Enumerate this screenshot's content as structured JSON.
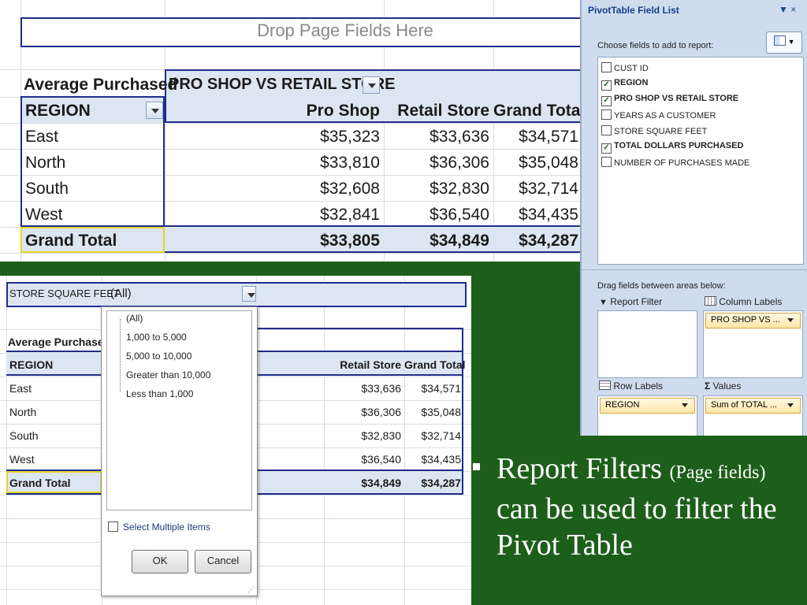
{
  "pivot_top": {
    "drop_zone": "Drop Page Fields Here",
    "data_label": "Average Purchased",
    "column_field": "PRO SHOP VS RETAIL STORE",
    "row_field": "REGION",
    "columns": [
      "Pro Shop",
      "Retail Store",
      "Grand Total"
    ],
    "rows": [
      {
        "label": "East",
        "values": [
          "$35,323",
          "$33,636",
          "$34,571"
        ]
      },
      {
        "label": "North",
        "values": [
          "$33,810",
          "$36,306",
          "$35,048"
        ]
      },
      {
        "label": "South",
        "values": [
          "$32,608",
          "$32,830",
          "$32,714"
        ]
      },
      {
        "label": "West",
        "values": [
          "$32,841",
          "$36,540",
          "$34,435"
        ]
      }
    ],
    "grand_total": {
      "label": "Grand Total",
      "values": [
        "$33,805",
        "$34,849",
        "$34,287"
      ]
    }
  },
  "field_list": {
    "title": "PivotTable Field List",
    "controls": "▼ ×",
    "choose_label": "Choose fields to add to report:",
    "fields": [
      {
        "name": "CUST ID",
        "checked": false
      },
      {
        "name": "REGION",
        "checked": true
      },
      {
        "name": "PRO SHOP VS RETAIL STORE",
        "checked": true
      },
      {
        "name": "YEARS AS A CUSTOMER",
        "checked": false
      },
      {
        "name": "STORE SQUARE FEET",
        "checked": false
      },
      {
        "name": "TOTAL DOLLARS PURCHASED",
        "checked": true
      },
      {
        "name": "NUMBER OF PURCHASES MADE",
        "checked": false
      }
    ],
    "drag_label": "Drag fields between areas below:",
    "report_filter_label": "Report Filter",
    "column_labels_label": "Column Labels",
    "column_pill": "PRO SHOP VS ...",
    "row_labels_label": "Row Labels",
    "values_label": "Values",
    "row_pill": "REGION",
    "values_pill": "Sum of TOTAL ..."
  },
  "pivot_bottom": {
    "filter_field": "STORE SQUARE FEET",
    "filter_value": "(All)",
    "data_label": "Average Purchased",
    "row_field": "REGION",
    "columns": [
      "Retail Store",
      "Grand Total"
    ],
    "rows": [
      {
        "label": "East",
        "values": [
          "$33,636",
          "$34,571"
        ]
      },
      {
        "label": "North",
        "values": [
          "$36,306",
          "$35,048"
        ]
      },
      {
        "label": "South",
        "values": [
          "$32,830",
          "$32,714"
        ]
      },
      {
        "label": "West",
        "values": [
          "$36,540",
          "$34,435"
        ]
      }
    ],
    "grand_total": {
      "label": "Grand Total",
      "values": [
        "$34,849",
        "$34,287"
      ]
    },
    "dropdown": {
      "items": [
        "(All)",
        "1,000 to 5,000",
        "5,000 to 10,000",
        "Greater than 10,000",
        "Less than 1,000"
      ],
      "select_multiple": "Select Multiple Items",
      "ok": "OK",
      "cancel": "Cancel"
    }
  },
  "bullet": {
    "part1": "Report Filters ",
    "part2": "(Page fields)",
    "part3": " can be used to filter the Pivot Table"
  }
}
